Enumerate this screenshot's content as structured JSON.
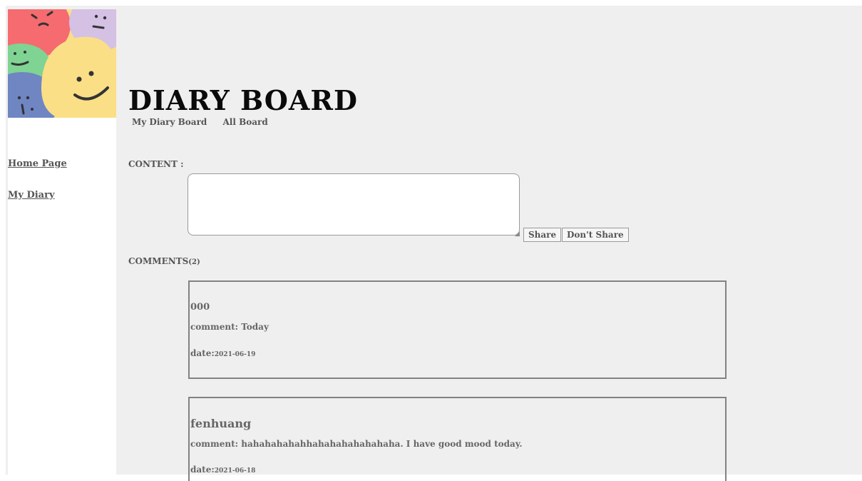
{
  "sidebar": {
    "nav": [
      {
        "label": "Home Page"
      },
      {
        "label": "My Diary"
      }
    ]
  },
  "header": {
    "title": "DIARY BOARD",
    "tabs": [
      "My Diary Board",
      "All Board"
    ]
  },
  "form": {
    "content_label": "CONTENT :",
    "share_label": "Share",
    "dont_share_label": "Don't Share"
  },
  "comments": {
    "label": "COMMENTS",
    "count": "(2)",
    "items": [
      {
        "author": "000",
        "comment": "comment: Today",
        "date_label": "date:",
        "date": "2021-06-19"
      },
      {
        "author": "fenhuang",
        "comment": "comment: hahahahahahhahahahahahahaha. I have good mood today.",
        "date_label": "date:",
        "date": "2021-06-18"
      }
    ]
  },
  "colors": {
    "background": "#efefef",
    "border": "#828282",
    "text": "#555555",
    "title": "#0a0a0a",
    "logo_red": "#f56b6f",
    "logo_purple": "#d5c1e3",
    "logo_green": "#7fd393",
    "logo_blue": "#6f86c2",
    "logo_yellow": "#fadf86"
  }
}
